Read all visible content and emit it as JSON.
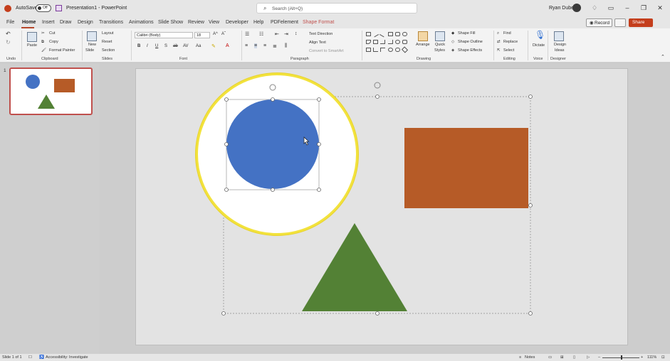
{
  "titlebar": {
    "autosave_label": "AutoSave",
    "autosave_state": "Off",
    "document_title": "Presentation1 - PowerPoint",
    "search_placeholder": "Search (Alt+Q)",
    "user_name": "Ryan Dube"
  },
  "menu": {
    "tabs": [
      "File",
      "Home",
      "Insert",
      "Draw",
      "Design",
      "Transitions",
      "Animations",
      "Slide Show",
      "Review",
      "View",
      "Developer",
      "Help",
      "PDFelement",
      "Shape Format"
    ],
    "active_tab": "Home",
    "record_label": "Record",
    "share_label": "Share"
  },
  "ribbon": {
    "groups": [
      "Undo",
      "Clipboard",
      "Slides",
      "Font",
      "Paragraph",
      "Drawing",
      "Editing",
      "Voice",
      "Designer"
    ],
    "clipboard": {
      "paste": "Paste",
      "cut": "Cut",
      "copy": "Copy",
      "format_painter": "Format Painter"
    },
    "slides": {
      "new_slide": "New",
      "new_slide_2": "Slide",
      "layout": "Layout",
      "reset": "Reset",
      "section": "Section"
    },
    "font": {
      "name": "Calibri (Body)",
      "size": "18",
      "format_buttons": [
        "B",
        "I",
        "U",
        "S",
        "ab",
        "AV",
        "Aa"
      ]
    },
    "paragraph": {
      "text_direction": "Text Direction",
      "align_text": "Align Text",
      "convert_smartart": "Convert to SmartArt"
    },
    "drawing": {
      "arrange": "Arrange",
      "quick_styles": "Quick",
      "quick_styles_2": "Styles",
      "shape_fill": "Shape Fill",
      "shape_outline": "Shape Outline",
      "shape_effects": "Shape Effects"
    },
    "editing": {
      "find": "Find",
      "replace": "Replace",
      "select": "Select"
    },
    "voice": {
      "dictate": "Dictate"
    },
    "designer": {
      "design_ideas": "Design",
      "design_ideas_2": "Ideas"
    }
  },
  "thumbnails": {
    "slide_number": "1"
  },
  "slide": {
    "shapes": [
      {
        "name": "circle",
        "color": "#4472c4"
      },
      {
        "name": "rectangle",
        "color": "#b65b27"
      },
      {
        "name": "triangle",
        "color": "#538135"
      }
    ]
  },
  "colors": {
    "accent": "#c43e1c",
    "highlight_ring": "#f2e23c"
  },
  "statusbar": {
    "slide_info": "Slide 1 of 1",
    "accessibility": "Accessibility: Investigate",
    "notes": "Notes",
    "zoom": "111%"
  }
}
